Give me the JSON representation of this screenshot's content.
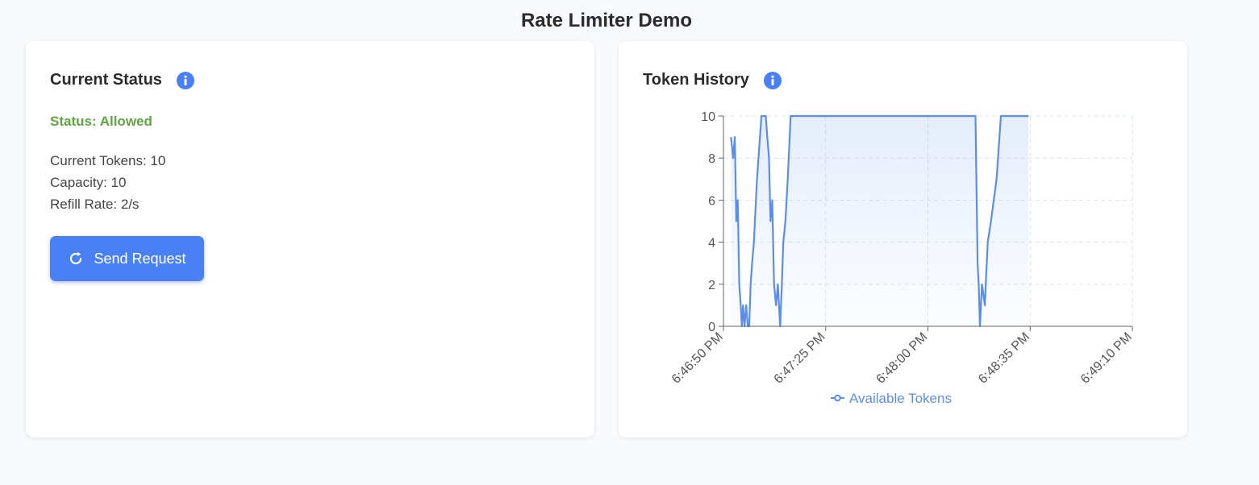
{
  "header": {
    "title": "Rate Limiter Demo"
  },
  "status_card": {
    "title": "Current Status",
    "info_icon": "info-icon",
    "status_text": "Status: Allowed",
    "status_color": "#5ea53f",
    "current_tokens": "Current Tokens: 10",
    "capacity": "Capacity: 10",
    "refill_rate": "Refill Rate: 2/s",
    "send_button_label": "Send Request",
    "send_button_icon": "refresh-icon",
    "accent_color": "#4a80f6"
  },
  "history_card": {
    "title": "Token History",
    "info_icon": "info-icon"
  },
  "chart_data": {
    "type": "area",
    "title": "",
    "xlabel": "",
    "ylabel": "",
    "ylim": [
      0,
      10
    ],
    "y_ticks": [
      "0",
      "2",
      "4",
      "6",
      "8",
      "10"
    ],
    "x_ticks": [
      "6:46:50 PM",
      "6:47:25 PM",
      "6:48:00 PM",
      "6:48:35 PM",
      "6:49:10 PM"
    ],
    "x_range_seconds": [
      0,
      140
    ],
    "grid": true,
    "legend_position": "bottom",
    "series": [
      {
        "name": "Available Tokens",
        "color": "#5b8ee8",
        "x": [
          2.6,
          3.3,
          3.9,
          4.4,
          4.9,
          5.4,
          5.9,
          6.3,
          6.7,
          7.2,
          7.8,
          8.3,
          8.8,
          9.3,
          9.8,
          10.4,
          11.5,
          13.0,
          14.5,
          15.0,
          15.6,
          16.1,
          16.7,
          17.3,
          18.0,
          18.6,
          19.4,
          20.0,
          20.5,
          21.2,
          22.0,
          23.0,
          24.5,
          25.5,
          47,
          70,
          86.3,
          87.0,
          87.4,
          87.8,
          88.5,
          89.5,
          89.8,
          90.5,
          91.6,
          93.5,
          95.0,
          96.0,
          104.4
        ],
        "values": [
          9,
          8,
          9,
          5,
          6,
          2,
          1,
          0,
          1,
          0,
          1,
          0,
          0,
          2,
          3,
          4,
          7,
          10,
          10,
          9,
          8,
          5,
          6,
          2,
          1,
          2,
          0,
          2,
          4,
          5,
          7,
          10,
          10,
          10,
          10,
          10,
          10,
          3,
          2,
          0,
          2,
          1,
          2,
          4,
          5,
          7,
          10,
          10,
          10
        ]
      }
    ]
  }
}
